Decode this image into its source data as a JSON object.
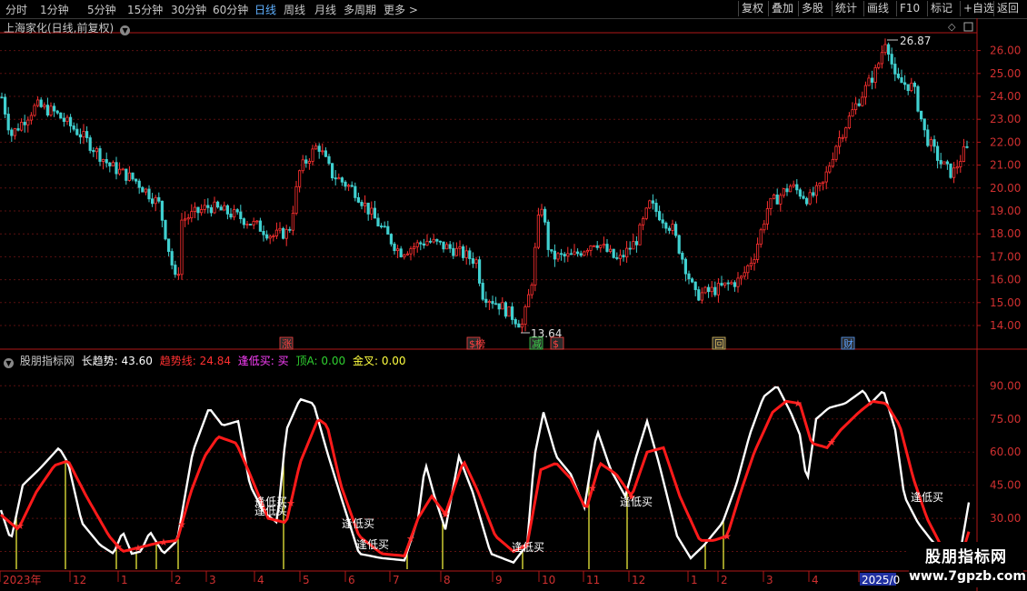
{
  "toolbar": {
    "timeframes": [
      "分时",
      "1分钟",
      "5分钟",
      "15分钟",
      "30分钟",
      "60分钟",
      "日线",
      "周线",
      "月线",
      "多周期",
      "更多 >"
    ],
    "active": "日线",
    "right_buttons": [
      "复权",
      "叠加",
      "多股",
      "统计",
      "画线",
      "F10",
      "标记",
      "+自选",
      "返回"
    ]
  },
  "price_panel": {
    "title": "上海家化(日线,前复权)",
    "y_ticks": [
      "26.00",
      "25.00",
      "24.00",
      "23.00",
      "22.00",
      "21.00",
      "20.00",
      "19.00",
      "18.00",
      "17.00",
      "16.00",
      "15.00",
      "14.00"
    ],
    "high_label": "26.87",
    "low_label": "13.64",
    "event_tags": [
      {
        "text": "涨",
        "color": "#ff4040"
      },
      {
        "text": "$榜",
        "color": "#ff4040"
      },
      {
        "text": "减",
        "color": "#3cd64c"
      },
      {
        "text": "$",
        "color": "#ff4040"
      },
      {
        "text": "回",
        "color": "#e0c060"
      },
      {
        "text": "财",
        "color": "#5aa0ff"
      }
    ]
  },
  "indicator_panel": {
    "name": "股朋指标网",
    "long_trend_label": "长趋势:",
    "long_trend_value": "43.60",
    "trend_line_label": "趋势线:",
    "trend_line_value": "24.84",
    "low_buy_label": "逢低买:",
    "low_buy_value": "买",
    "top_a_label": "顶A:",
    "top_a_value": "0.00",
    "golden_cross_label": "金叉:",
    "golden_cross_value": "0.00",
    "y_ticks": [
      "90.00",
      "75.00",
      "60.00",
      "45.00",
      "30.00",
      "15.00"
    ],
    "annotations": [
      "逢低买",
      "逢低买",
      "逢低买",
      "逢低买",
      "逢低买",
      "逢低买",
      "逢低买"
    ],
    "colors": {
      "long_trend": "#ffffff",
      "trend_line": "#ff2020",
      "low_buy": "#ff40ff",
      "top_a": "#30d030",
      "golden_cross": "#ffff40"
    }
  },
  "date_axis": {
    "labels": [
      "2023年",
      "12",
      "1",
      "2",
      "3",
      "4",
      "5",
      "6",
      "7",
      "8",
      "9",
      "10",
      "11",
      "12",
      "1",
      "2",
      "3",
      "4",
      "2025/0"
    ]
  },
  "watermark": {
    "line1": "股朋指标网",
    "line2": "www.7gpzb.com"
  }
}
